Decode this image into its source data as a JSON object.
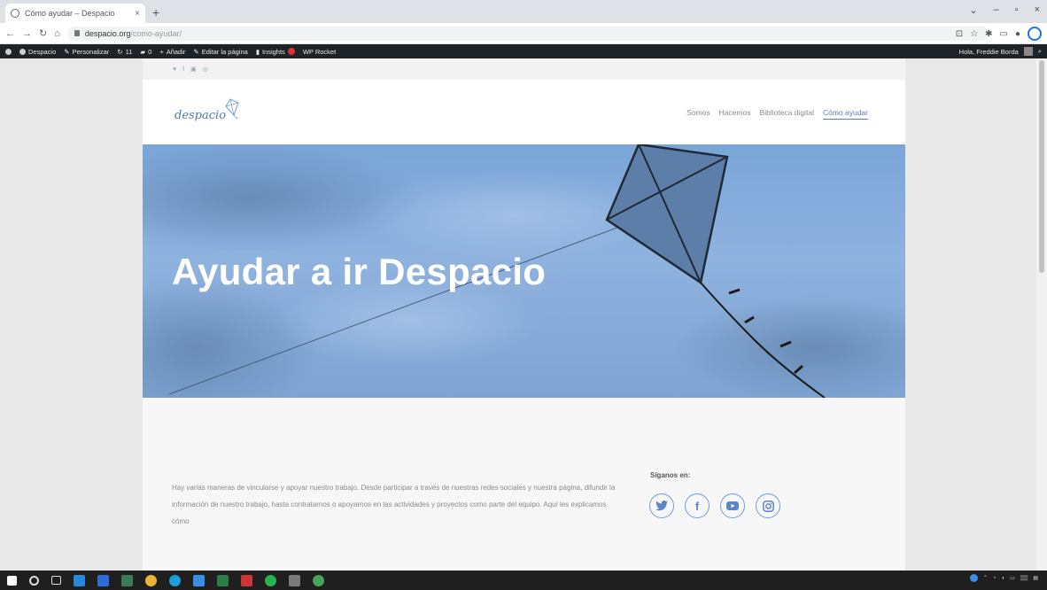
{
  "browser": {
    "tab_title": "Cómo ayudar – Despacio",
    "tab_close": "×",
    "new_tab": "+",
    "window_controls": [
      "⌄",
      "–",
      "▫",
      "×"
    ],
    "url_domain": "despacio.org",
    "url_path": "/como-ayudar/"
  },
  "wp_admin_bar": {
    "items": [
      "Despacio",
      "Personalizar",
      "11",
      "0",
      "Añadir",
      "Editar la página",
      "Insights",
      "WP Rocket"
    ],
    "greeting": "Hola, Freddie Borda"
  },
  "site": {
    "logo_text": "despacio",
    "top_social": [
      "♥",
      "f",
      "▣",
      "◎"
    ],
    "menu": [
      "Somos",
      "Hacemos",
      "Biblioteca digital",
      "Cómo ayudar"
    ],
    "hero_title": "Ayudar a ir Despacio",
    "intro_text": "Hay varias maneras de vincularse y apoyar nuestro trabajo. Desde participar a través de nuestras redes sociales y nuestra página, difundir la información de nuestro trabajo, hasta contratarnos o apoyarnos en las actividades y proyectos como parte del equipo. Aquí les explicamos cómo",
    "follow_label": "Síganos en:",
    "social_icons": [
      "twitter-icon",
      "facebook-icon",
      "youtube-icon",
      "instagram-icon"
    ]
  },
  "colors": {
    "accent": "#5a86c8",
    "hero_sky": "#7aa5d8",
    "wp_bar": "#1d2327"
  }
}
